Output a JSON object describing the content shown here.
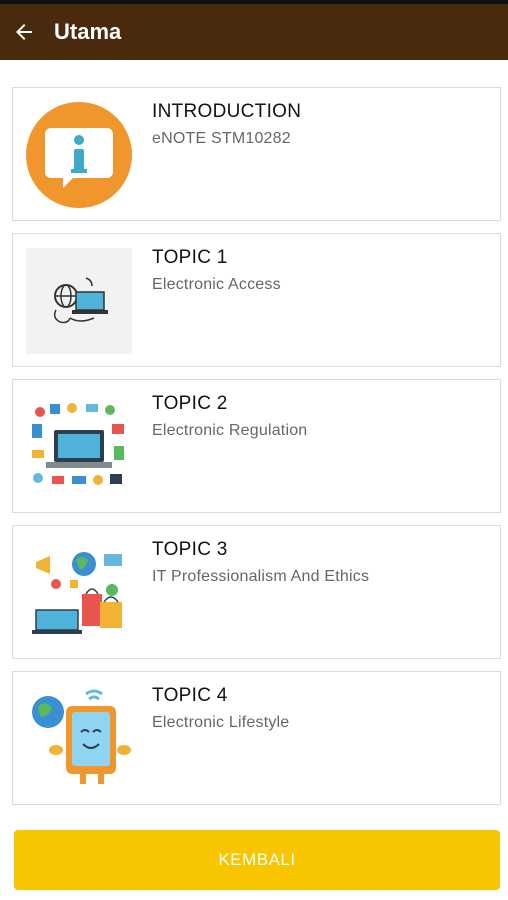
{
  "appbar": {
    "title": "Utama",
    "back_icon": "arrow-left-icon",
    "background": "#4a2a0d"
  },
  "items": [
    {
      "title": "INTRODUCTION",
      "subtitle": "eNOTE STM10282",
      "icon": "info-speech-bubble-icon"
    },
    {
      "title": "TOPIC 1",
      "subtitle": "Electronic Access",
      "icon": "electronic-access-illustration"
    },
    {
      "title": "TOPIC 2",
      "subtitle": "Electronic Regulation",
      "icon": "laptop-devices-illustration"
    },
    {
      "title": "TOPIC 3",
      "subtitle": "IT Professionalism And Ethics",
      "icon": "ecommerce-illustration"
    },
    {
      "title": "TOPIC 4",
      "subtitle": "Electronic Lifestyle",
      "icon": "smiling-tablet-illustration"
    }
  ],
  "footer": {
    "button_label": "KEMBALI",
    "button_color": "#f7c600"
  }
}
